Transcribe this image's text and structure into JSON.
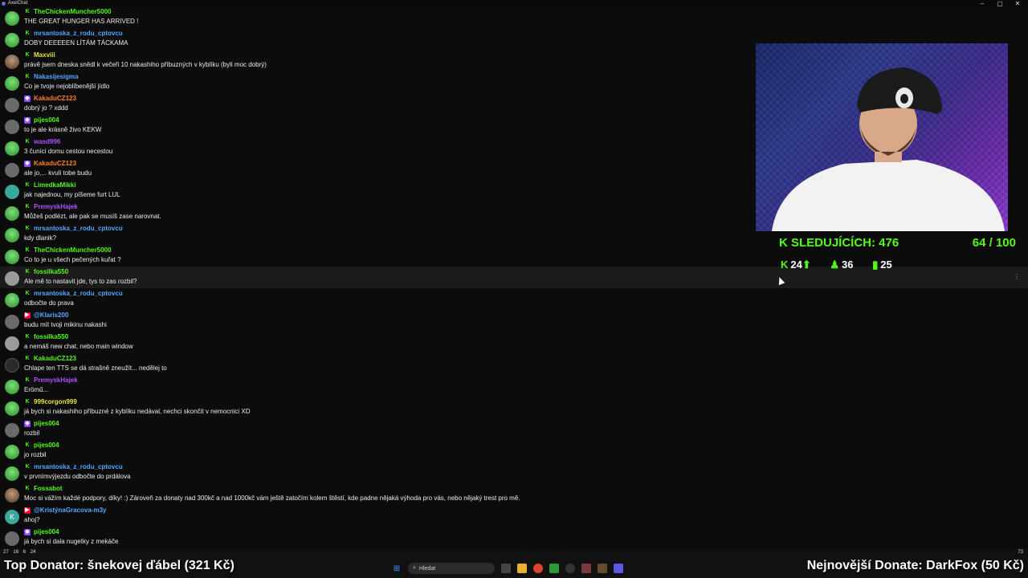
{
  "window": {
    "title": "AxelChat",
    "controls": [
      "–",
      "▢",
      "✕"
    ]
  },
  "chat": [
    {
      "badge": "kick",
      "user": "TheChickenMuncher5000",
      "color": "#53fc18",
      "avatar": "green",
      "text": "THE GREAT HUNGER HAS ARRIVED !"
    },
    {
      "badge": "kick",
      "user": "mrsantoska_z_rodu_cptovcu",
      "color": "#53a8ff",
      "avatar": "green",
      "text": "DOBY DEEEEEN LÍTÁM TÁCKAMA"
    },
    {
      "badge": "kick",
      "user": "Maxviii",
      "color": "#e6e63a",
      "avatar": "photo",
      "text": "právě jsem dneska snědl k večeři 10 nakashiho příbuzných v kyblíku (byli moc dobrý)"
    },
    {
      "badge": "kick",
      "user": "Nakasijesigma",
      "color": "#53a8ff",
      "avatar": "green",
      "text": "Co je tvoje nejoblíbenější jídlo"
    },
    {
      "badge": "twitch",
      "user": "KakaduCZ123",
      "color": "#ff7f24",
      "avatar": "grey",
      "text": "dobrý jo ? xddd"
    },
    {
      "badge": "twitch",
      "user": "pijes004",
      "color": "#53fc18",
      "avatar": "grey",
      "text": "to je ale krásně živo KEKW"
    },
    {
      "badge": "kick",
      "user": "wasd996",
      "color": "#b054ff",
      "avatar": "green",
      "text": "3 čuníci domu cestou necestou"
    },
    {
      "badge": "twitch",
      "user": "KakaduCZ123",
      "color": "#ff7f24",
      "avatar": "grey",
      "text": "ale jo,... kvuli tobe budu"
    },
    {
      "badge": "kick",
      "user": "LimedkaMikki",
      "color": "#53fc18",
      "avatar": "teal",
      "text": "jak najednou, my píšeme furt LUL"
    },
    {
      "badge": "kick",
      "user": "PremyskHajek",
      "color": "#b054ff",
      "avatar": "green",
      "text": "Můžeš podlézt, ale pak se musíš zase narovnat."
    },
    {
      "badge": "kick",
      "user": "mrsantoska_z_rodu_cptovcu",
      "color": "#53a8ff",
      "avatar": "green",
      "text": "kdy dlanik?"
    },
    {
      "badge": "kick",
      "user": "TheChickenMuncher5000",
      "color": "#53fc18",
      "avatar": "green",
      "text": "Co to je u všech pečených kuřat ?"
    },
    {
      "badge": "kick",
      "user": "fossilka550",
      "color": "#53fc18",
      "avatar": "gray2",
      "text": "Ale mě to nastavit jde, tys to zas rozbil?",
      "highlight": true
    },
    {
      "badge": "kick",
      "user": "mrsantoska_z_rodu_cptovcu",
      "color": "#53a8ff",
      "avatar": "green",
      "text": "odbočte do prava"
    },
    {
      "badge": "youtube",
      "user": "@Klaris200",
      "color": "#53a8ff",
      "avatar": "grey",
      "text": "budu mít tvoji mikinu nakashi"
    },
    {
      "badge": "kick",
      "user": "fossilka550",
      "color": "#53fc18",
      "avatar": "gray2",
      "text": "a nemáš new chat, nebo main window"
    },
    {
      "badge": "kick",
      "user": "KakaduCZ123",
      "color": "#53fc18",
      "avatar": "dark",
      "text": "Chlape ten TTS se dá strašně zneužít... nedělej to"
    },
    {
      "badge": "kick",
      "user": "PremyskHajek",
      "color": "#b054ff",
      "avatar": "green",
      "text": "Erömű..."
    },
    {
      "badge": "kick",
      "user": "999corgon999",
      "color": "#e6e63a",
      "avatar": "green",
      "text": "já bych si nakashiho příbuzné z kyblíku nedával, nechci skončit v nemocnici XD"
    },
    {
      "badge": "twitch",
      "user": "pijes004",
      "color": "#53fc18",
      "avatar": "grey",
      "text": "rozbil"
    },
    {
      "badge": "kick",
      "user": "pijes004",
      "color": "#53fc18",
      "avatar": "green",
      "text": "jo rozbil"
    },
    {
      "badge": "kick",
      "user": "mrsantoska_z_rodu_cptovcu",
      "color": "#53a8ff",
      "avatar": "green",
      "text": "v prvnímvýjezdu odbočte do prdálova"
    },
    {
      "badge": "kick",
      "user": "Fossabot",
      "color": "#53fc18",
      "avatar": "photo",
      "text": "Moc si vážím každé podpory, díky! :) Zároveň za donaty nad 300kč a nad 1000kč vám ještě zatočím kolem štěstí, kde padne nějaká výhoda pro vás, nebo nějaký trest pro mě."
    },
    {
      "badge": "youtube",
      "user": "@KristýnaGracova-m3y",
      "color": "#53a8ff",
      "avatar": "teal",
      "avatar_letter": "K",
      "text": "ahoj?"
    },
    {
      "badge": "twitch",
      "user": "pijes004",
      "color": "#53fc18",
      "avatar": "grey",
      "text": "já bych si dala nugetky z mekáče"
    }
  ],
  "stats": {
    "viewers_label": "SLEDUJÍCÍCH: 476",
    "goal": "64 / 100",
    "kick_followers": "24",
    "followers": "36",
    "subs": "25"
  },
  "bottom": {
    "counters": [
      "27",
      "16",
      "6",
      "24"
    ],
    "top_donator": "Top Donator: šnekovej ďábel (321 Kč)",
    "newest_donate": "Nejnovější Donate: DarkFox (50 Kč)",
    "search_placeholder": "Hledat",
    "tray_count": "73"
  },
  "colors": {
    "kick": "#53fc18",
    "twitch": "#9146ff",
    "youtube": "#ff0033"
  }
}
